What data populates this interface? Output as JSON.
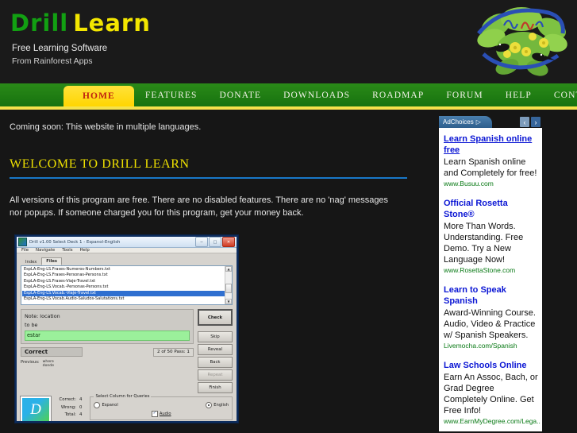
{
  "site": {
    "brand_word1": "Drill",
    "brand_word2": "Learn",
    "brand_color1": "#12a012",
    "brand_color2": "#f3e600",
    "tagline1": "Free Learning Software",
    "tagline2": "From Rainforest Apps",
    "logo_alt": "rainforest-parrot-logo"
  },
  "nav": {
    "items": [
      {
        "label": "Home",
        "active": true
      },
      {
        "label": "Features",
        "active": false
      },
      {
        "label": "Donate",
        "active": false
      },
      {
        "label": "Downloads",
        "active": false
      },
      {
        "label": "Roadmap",
        "active": false
      },
      {
        "label": "Forum",
        "active": false
      },
      {
        "label": "Help",
        "active": false
      },
      {
        "label": "Contact Us",
        "active": false
      }
    ],
    "bar_color": "#1e7a12",
    "active_color": "#ffd500",
    "active_text_color": "#c01f10"
  },
  "main": {
    "notice": "Coming soon: This website in multiple languages.",
    "heading": "Welcome to Drill Learn",
    "heading_rule_color": "#1878c8",
    "paragraph": "All versions of this program are free. There are no disabled features. There are no 'nag' messages nor popups. If someone charged you for this program, get your money back."
  },
  "app_screenshot": {
    "window_title": "Drill v1.00  Select Deck 1 - Espanol-English",
    "window_buttons": {
      "minimize": "─",
      "maximize": "□",
      "close": "✕"
    },
    "menus": [
      "File",
      "Navigate",
      "Tools",
      "Help"
    ],
    "tabs": [
      {
        "label": "Index",
        "active": false
      },
      {
        "label": "Files",
        "active": true
      }
    ],
    "file_list": [
      {
        "name": "EspLA-Eng-LS.Frases-Numeros-Numbers.txt",
        "selected": false
      },
      {
        "name": "EspLA-Eng-LS.Frases-Personas-Persons.txt",
        "selected": false
      },
      {
        "name": "EspLA-Eng-LS.Frases-Viaje-Travel.txt",
        "selected": false
      },
      {
        "name": "EspLA-Eng-LS.Vocab.-Personas-Persons.txt",
        "selected": false
      },
      {
        "name": "EspLA-Eng-LS.Vocab.-Viaje-Travel.txt",
        "selected": true
      },
      {
        "name": "EspLA-Eng-LS.Vocab.Audio-Saludos-Salutations.txt",
        "selected": false
      }
    ],
    "quiz": {
      "note_label": "Note: location",
      "prompt": "to be",
      "answer": "estar",
      "status": "Correct",
      "counter": "2 of 50   Pass: 1",
      "previous_label": "Previous:",
      "previous_values": [
        "where",
        "donde"
      ]
    },
    "buttons": [
      {
        "label": "Check",
        "primary": true,
        "disabled": false
      },
      {
        "label": "Skip",
        "primary": false,
        "disabled": false
      },
      {
        "label": "Reveal",
        "primary": false,
        "disabled": false
      },
      {
        "label": "Back",
        "primary": false,
        "disabled": false
      },
      {
        "label": "Repeat",
        "primary": false,
        "disabled": true
      },
      {
        "label": "Finish",
        "primary": false,
        "disabled": false
      }
    ],
    "deck_logo_letter": "D",
    "stats": [
      {
        "label": "Correct:",
        "value": "4"
      },
      {
        "label": "Wrong:",
        "value": "0"
      },
      {
        "label": "Total:",
        "value": "4"
      }
    ],
    "column_group": {
      "title": "Select Column for Queries",
      "radios": [
        {
          "label": "Espanol",
          "selected": false
        },
        {
          "label": "English",
          "selected": true
        }
      ],
      "checkbox": {
        "label": "Audio",
        "checked": true
      }
    }
  },
  "ads": {
    "adchoices_label": "AdChoices",
    "prev_arrow": "‹",
    "next_arrow": "›",
    "items": [
      {
        "title": "Learn Spanish online free",
        "body": "Learn Spanish online and Completely for free!",
        "url": "www.Busuu.com"
      },
      {
        "title": "Official Rosetta Stone®",
        "body": "More Than Words. Understanding. Free Demo. Try a New Language Now!",
        "url": "www.RosettaStone.com"
      },
      {
        "title": "Learn to Speak Spanish",
        "body": "Award-Winning Course. Audio, Video & Practice w/ Spanish Speakers.",
        "url": "Livemocha.com/Spanish"
      },
      {
        "title": "Law Schools Online",
        "body": "Earn An Assoc, Bach, or Grad Degree Completely Online. Get Free Info!",
        "url": "www.EarnMyDegree.com/Lega.."
      }
    ]
  }
}
